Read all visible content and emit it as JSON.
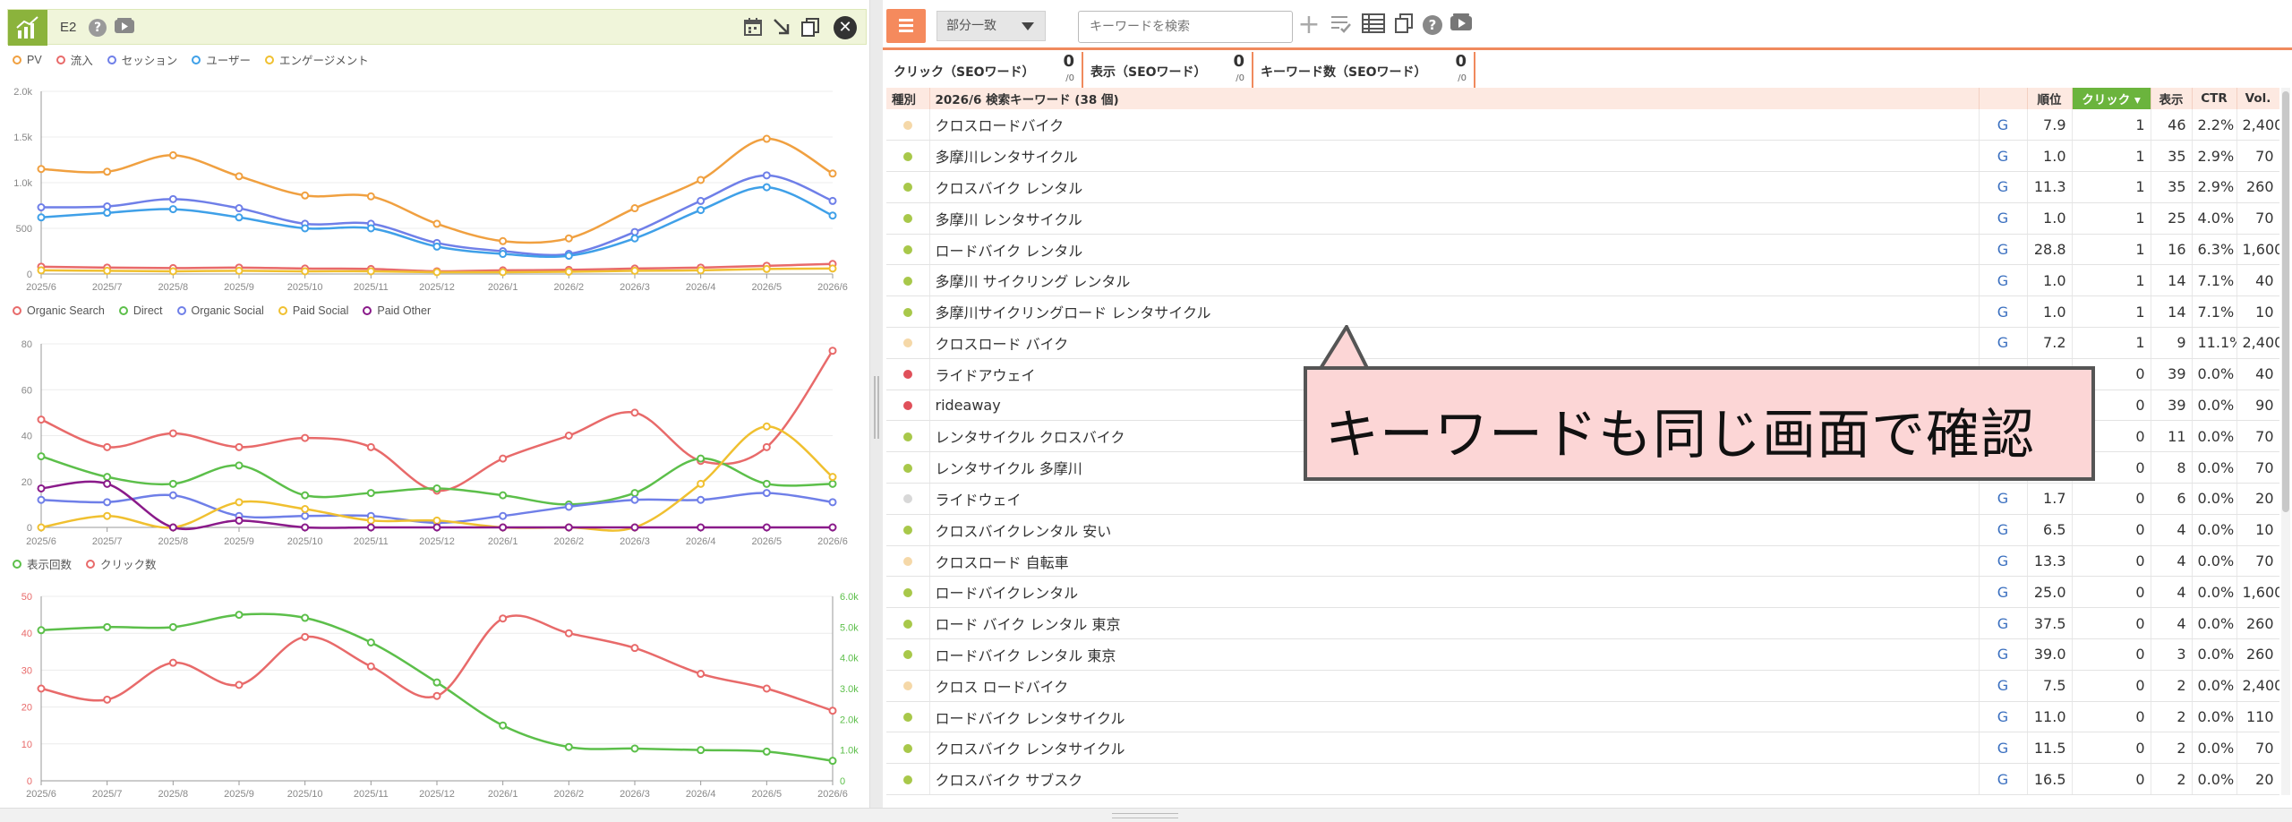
{
  "left_panel": {
    "title": "E2",
    "icons": [
      "chart-icon",
      "help-icon",
      "video-icon",
      "calendar-icon",
      "expand-icon",
      "copy-icon",
      "close-icon"
    ]
  },
  "charts": [
    {
      "type": "line",
      "legend": [
        "PV",
        "流入",
        "セッション",
        "ユーザー",
        "エンゲージメント"
      ],
      "x": [
        "2025/6",
        "2025/7",
        "2025/8",
        "2025/9",
        "2025/10",
        "2025/11",
        "2025/12",
        "2026/1",
        "2026/2",
        "2026/3",
        "2026/4",
        "2026/5",
        "2026/6"
      ],
      "y_ticks": [
        "0",
        "500",
        "1.0k",
        "1.5k",
        "2.0k"
      ],
      "ylim": [
        0,
        2000
      ],
      "series": [
        {
          "name": "PV",
          "color": "#f0a040",
          "values": [
            1150,
            1120,
            1300,
            1070,
            860,
            850,
            550,
            360,
            390,
            720,
            1030,
            1480,
            1100
          ]
        },
        {
          "name": "流入",
          "color": "#e86a6a",
          "values": [
            80,
            70,
            65,
            70,
            60,
            55,
            30,
            40,
            45,
            60,
            70,
            90,
            110
          ]
        },
        {
          "name": "セッション",
          "color": "#6f7fe8",
          "values": [
            730,
            740,
            820,
            720,
            550,
            550,
            340,
            250,
            220,
            460,
            800,
            1080,
            800
          ]
        },
        {
          "name": "ユーザー",
          "color": "#3fa0e8",
          "values": [
            620,
            670,
            710,
            620,
            500,
            500,
            300,
            220,
            200,
            390,
            700,
            950,
            640
          ]
        },
        {
          "name": "エンゲージメント",
          "color": "#f0c030",
          "values": [
            40,
            35,
            30,
            35,
            30,
            30,
            20,
            20,
            25,
            35,
            40,
            55,
            60
          ]
        }
      ]
    },
    {
      "type": "line",
      "legend": [
        "Organic Search",
        "Direct",
        "Organic Social",
        "Paid Social",
        "Paid Other"
      ],
      "x": [
        "2025/6",
        "2025/7",
        "2025/8",
        "2025/9",
        "2025/10",
        "2025/11",
        "2025/12",
        "2026/1",
        "2026/2",
        "2026/3",
        "2026/4",
        "2026/5",
        "2026/6"
      ],
      "y_ticks": [
        "0",
        "20",
        "40",
        "60",
        "80"
      ],
      "ylim": [
        0,
        80
      ],
      "series": [
        {
          "name": "Organic Search",
          "color": "#e86a6a",
          "values": [
            47,
            35,
            41,
            35,
            39,
            35,
            16,
            30,
            40,
            50,
            29,
            35,
            77
          ]
        },
        {
          "name": "Direct",
          "color": "#5cbf4a",
          "values": [
            31,
            22,
            19,
            27,
            14,
            15,
            17,
            14,
            10,
            15,
            30,
            19,
            19
          ]
        },
        {
          "name": "Organic Social",
          "color": "#6f7fe8",
          "values": [
            12,
            11,
            14,
            5,
            5,
            5,
            2,
            5,
            9,
            12,
            12,
            15,
            11
          ]
        },
        {
          "name": "Paid Social",
          "color": "#f0c030",
          "values": [
            0,
            5,
            0,
            11,
            8,
            3,
            3,
            0,
            0,
            0,
            19,
            44,
            22
          ]
        },
        {
          "name": "Paid Other",
          "color": "#8a1a8a",
          "values": [
            17,
            19,
            0,
            3,
            0,
            0,
            0,
            0,
            0,
            0,
            0,
            0,
            0
          ]
        }
      ]
    },
    {
      "type": "line",
      "legend": [
        "表示回数",
        "クリック数"
      ],
      "x": [
        "2025/6",
        "2025/7",
        "2025/8",
        "2025/9",
        "2025/10",
        "2025/11",
        "2025/12",
        "2026/1",
        "2026/2",
        "2026/3",
        "2026/4",
        "2026/5",
        "2026/6"
      ],
      "y_ticks": [
        "0",
        "10",
        "20",
        "30",
        "40",
        "50"
      ],
      "y2_ticks": [
        "0",
        "1.0k",
        "2.0k",
        "3.0k",
        "4.0k",
        "5.0k",
        "6.0k"
      ],
      "ylim": [
        0,
        50
      ],
      "y2lim": [
        0,
        6000
      ],
      "series": [
        {
          "name": "表示回数",
          "color": "#5cbf4a",
          "axis": "right",
          "values": [
            4900,
            5000,
            5000,
            5400,
            5300,
            4500,
            3200,
            1800,
            1100,
            1050,
            1000,
            950,
            650
          ]
        },
        {
          "name": "クリック数",
          "color": "#e86a6a",
          "axis": "left",
          "values": [
            25,
            22,
            32,
            26,
            39,
            31,
            23,
            44,
            40,
            36,
            29,
            25,
            19
          ]
        }
      ]
    }
  ],
  "toolbar": {
    "match_select": "部分一致",
    "search_placeholder": "キーワードを検索",
    "icons": [
      "add-icon",
      "filter-list-icon",
      "table-icon",
      "copy-icon",
      "help-icon",
      "video-icon"
    ]
  },
  "stats": [
    {
      "label": "クリック（SEOワード）",
      "value": "0",
      "sub": "/0"
    },
    {
      "label": "表示（SEOワード）",
      "value": "0",
      "sub": "/0"
    },
    {
      "label": "キーワード数（SEOワード）",
      "value": "0",
      "sub": "/0"
    }
  ],
  "table": {
    "headers": {
      "type": "種別",
      "keyword": "2026/6 検索キーワード (38 個)",
      "rank": "順位",
      "click": "クリック ▾",
      "impr": "表示",
      "ctr": "CTR",
      "vol": "Vol."
    },
    "rows": [
      {
        "dot": "#f5d8a8",
        "kw": "クロスロードバイク",
        "g": "G",
        "rank": "7.9",
        "click": "1",
        "impr": "46",
        "ctr": "2.2%",
        "vol": "2,400"
      },
      {
        "dot": "#a8c84a",
        "kw": "多摩川レンタサイクル",
        "g": "G",
        "rank": "1.0",
        "click": "1",
        "impr": "35",
        "ctr": "2.9%",
        "vol": "70"
      },
      {
        "dot": "#a8c84a",
        "kw": "クロスバイク レンタル",
        "g": "G",
        "rank": "11.3",
        "click": "1",
        "impr": "35",
        "ctr": "2.9%",
        "vol": "260"
      },
      {
        "dot": "#a8c84a",
        "kw": "多摩川 レンタサイクル",
        "g": "G",
        "rank": "1.0",
        "click": "1",
        "impr": "25",
        "ctr": "4.0%",
        "vol": "70"
      },
      {
        "dot": "#a8c84a",
        "kw": "ロードバイク レンタル",
        "g": "G",
        "rank": "28.8",
        "click": "1",
        "impr": "16",
        "ctr": "6.3%",
        "vol": "1,600"
      },
      {
        "dot": "#a8c84a",
        "kw": "多摩川 サイクリング レンタル",
        "g": "G",
        "rank": "1.0",
        "click": "1",
        "impr": "14",
        "ctr": "7.1%",
        "vol": "40"
      },
      {
        "dot": "#a8c84a",
        "kw": "多摩川サイクリングロード レンタサイクル",
        "g": "G",
        "rank": "1.0",
        "click": "1",
        "impr": "14",
        "ctr": "7.1%",
        "vol": "10"
      },
      {
        "dot": "#f5d8a8",
        "kw": "クロスロード バイク",
        "g": "G",
        "rank": "7.2",
        "click": "1",
        "impr": "9",
        "ctr": "11.1%",
        "vol": "2,400"
      },
      {
        "dot": "#e0505a",
        "kw": "ライドアウェイ",
        "g": "",
        "rank": "",
        "click": "0",
        "impr": "39",
        "ctr": "0.0%",
        "vol": "40"
      },
      {
        "dot": "#e0505a",
        "kw": "rideaway",
        "g": "",
        "rank": "",
        "click": "0",
        "impr": "39",
        "ctr": "0.0%",
        "vol": "90"
      },
      {
        "dot": "#a8c84a",
        "kw": "レンタサイクル クロスバイク",
        "g": "",
        "rank": "",
        "click": "0",
        "impr": "11",
        "ctr": "0.0%",
        "vol": "70"
      },
      {
        "dot": "#a8c84a",
        "kw": "レンタサイクル 多摩川",
        "g": "",
        "rank": "",
        "click": "0",
        "impr": "8",
        "ctr": "0.0%",
        "vol": "70"
      },
      {
        "dot": "#d8d8d8",
        "kw": "ライドウェイ",
        "g": "G",
        "rank": "1.7",
        "click": "0",
        "impr": "6",
        "ctr": "0.0%",
        "vol": "20"
      },
      {
        "dot": "#a8c84a",
        "kw": "クロスバイクレンタル 安い",
        "g": "G",
        "rank": "6.5",
        "click": "0",
        "impr": "4",
        "ctr": "0.0%",
        "vol": "10"
      },
      {
        "dot": "#f5d8a8",
        "kw": "クロスロード 自転車",
        "g": "G",
        "rank": "13.3",
        "click": "0",
        "impr": "4",
        "ctr": "0.0%",
        "vol": "70"
      },
      {
        "dot": "#a8c84a",
        "kw": "ロードバイクレンタル",
        "g": "G",
        "rank": "25.0",
        "click": "0",
        "impr": "4",
        "ctr": "0.0%",
        "vol": "1,600"
      },
      {
        "dot": "#a8c84a",
        "kw": "ロード バイク レンタル 東京",
        "g": "G",
        "rank": "37.5",
        "click": "0",
        "impr": "4",
        "ctr": "0.0%",
        "vol": "260"
      },
      {
        "dot": "#a8c84a",
        "kw": "ロードバイク レンタル 東京",
        "g": "G",
        "rank": "39.0",
        "click": "0",
        "impr": "3",
        "ctr": "0.0%",
        "vol": "260"
      },
      {
        "dot": "#f5d8a8",
        "kw": "クロス ロードバイク",
        "g": "G",
        "rank": "7.5",
        "click": "0",
        "impr": "2",
        "ctr": "0.0%",
        "vol": "2,400"
      },
      {
        "dot": "#a8c84a",
        "kw": "ロードバイク レンタサイクル",
        "g": "G",
        "rank": "11.0",
        "click": "0",
        "impr": "2",
        "ctr": "0.0%",
        "vol": "110"
      },
      {
        "dot": "#a8c84a",
        "kw": "クロスバイク レンタサイクル",
        "g": "G",
        "rank": "11.5",
        "click": "0",
        "impr": "2",
        "ctr": "0.0%",
        "vol": "70"
      },
      {
        "dot": "#a8c84a",
        "kw": "クロスバイク サブスク",
        "g": "G",
        "rank": "16.5",
        "click": "0",
        "impr": "2",
        "ctr": "0.0%",
        "vol": "20"
      }
    ]
  },
  "callout": {
    "text": "キーワードも同じ画面で確認"
  }
}
